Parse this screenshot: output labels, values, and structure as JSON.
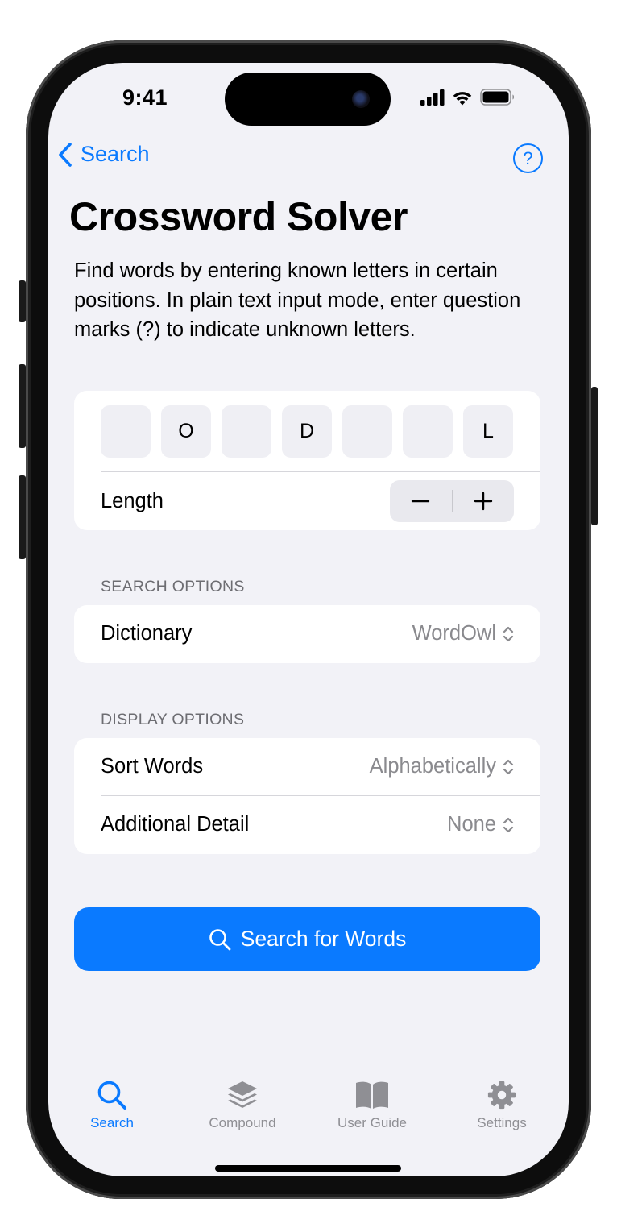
{
  "status_bar": {
    "time": "9:41"
  },
  "nav": {
    "back_label": "Search",
    "help_glyph": "?"
  },
  "page": {
    "title": "Crossword Solver",
    "description": "Find words by entering known letters in certain positions. In plain text input mode, enter question marks (?) to indicate unknown letters."
  },
  "pattern": {
    "letters": [
      "",
      "O",
      "",
      "D",
      "",
      "",
      "L"
    ],
    "length_label": "Length",
    "decrement_glyph": "−",
    "increment_glyph": "+"
  },
  "search_options": {
    "header": "SEARCH OPTIONS",
    "dictionary_label": "Dictionary",
    "dictionary_value": "WordOwl"
  },
  "display_options": {
    "header": "DISPLAY OPTIONS",
    "sort_label": "Sort Words",
    "sort_value": "Alphabetically",
    "detail_label": "Additional Detail",
    "detail_value": "None"
  },
  "search_button": {
    "label": "Search for Words"
  },
  "tab_bar": {
    "items": [
      {
        "label": "Search",
        "icon": "magnifier-icon",
        "active": true
      },
      {
        "label": "Compound",
        "icon": "layers-icon",
        "active": false
      },
      {
        "label": "User Guide",
        "icon": "book-icon",
        "active": false
      },
      {
        "label": "Settings",
        "icon": "gear-icon",
        "active": false
      }
    ]
  },
  "colors": {
    "accent": "#0a7aff",
    "background": "#f2f2f7",
    "secondary_text": "#8a8a8e"
  }
}
